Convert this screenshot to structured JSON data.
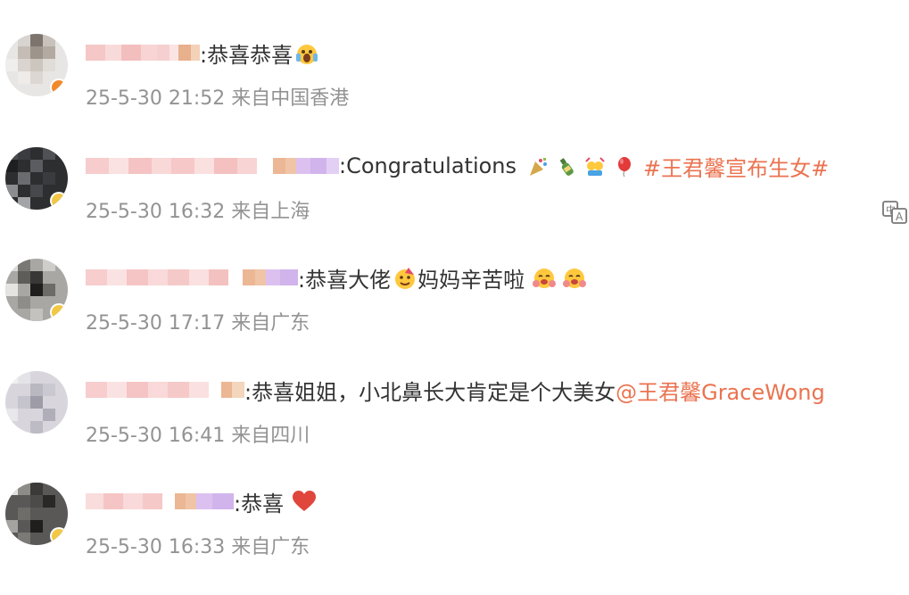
{
  "comments": [
    {
      "text": ":恭喜恭喜",
      "time": "25-5-30 21:52",
      "source": "来自中国香港",
      "emoji": [
        "screaming-face-icon"
      ]
    },
    {
      "text": ":Congratulations",
      "time": "25-5-30 16:32",
      "source": "来自上海",
      "emoji": [
        "party-popper-icon",
        "champagne-icon",
        "celebrating-people-icon",
        "balloon-icon"
      ],
      "topic": "#王君馨宣布生女#",
      "translate_icon": "translate-icon"
    },
    {
      "text_before": ":恭喜大佬",
      "text_after": "妈妈辛苦啦",
      "time": "25-5-30 17:17",
      "source": "来自广东",
      "emoji": [
        "party-face-icon",
        "hugging-face-icon",
        "hugging-face-icon"
      ]
    },
    {
      "text": ":恭喜姐姐，小北鼻长大肯定是个大美女",
      "mention": "@王君馨GraceWong",
      "time": "25-5-30 16:41",
      "source": "来自四川"
    },
    {
      "text": ":恭喜",
      "time": "25-5-30 16:33",
      "source": "来自广东",
      "emoji": [
        "red-heart-icon"
      ]
    }
  ],
  "colors": {
    "topic": "#eb7350",
    "meta": "#939393",
    "text": "#333333"
  }
}
